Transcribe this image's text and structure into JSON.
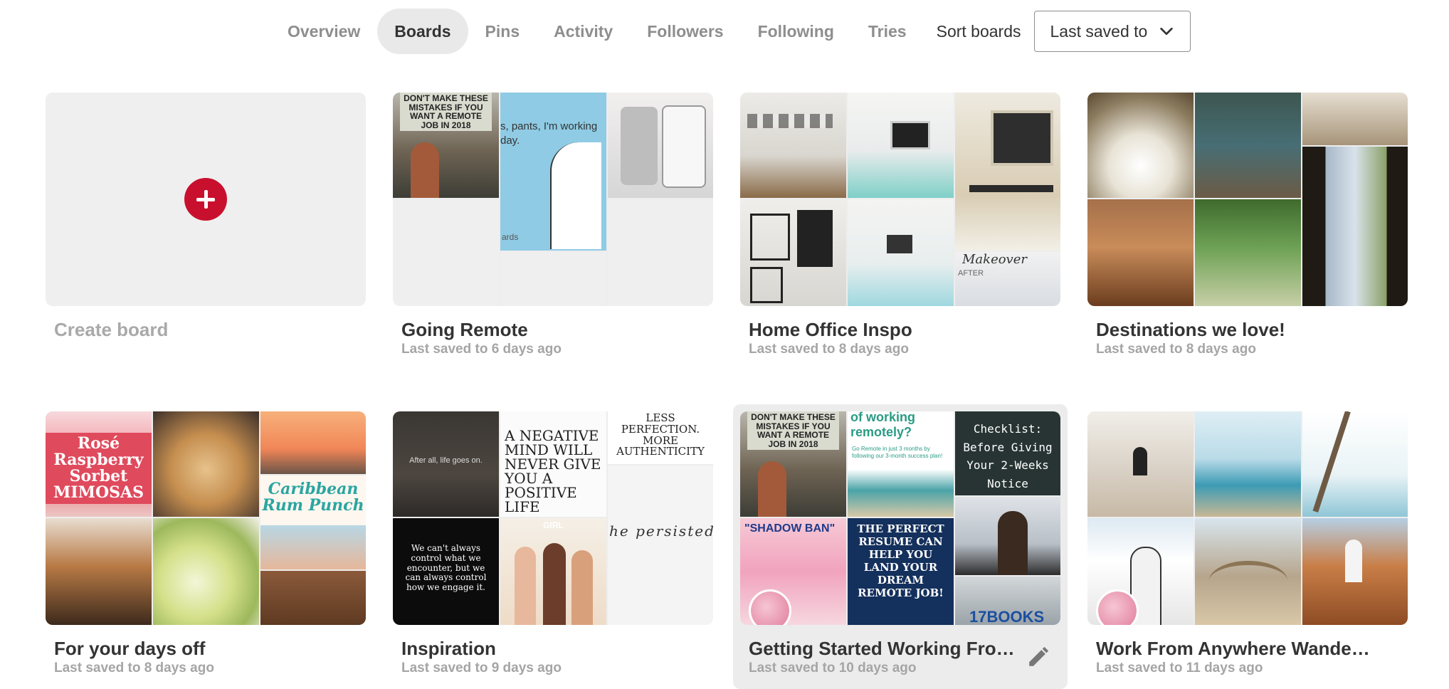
{
  "nav": {
    "tabs": [
      "Overview",
      "Boards",
      "Pins",
      "Activity",
      "Followers",
      "Following",
      "Tries"
    ],
    "active_tab": "Boards",
    "sort_label": "Sort boards",
    "sort_value": "Last saved to"
  },
  "create_board": {
    "label": "Create board"
  },
  "boards": [
    {
      "title": "Going Remote",
      "meta": "Last saved to 6 days ago",
      "tile_texts": [
        "DON'T MAKE THESE MISTAKES IF YOU WANT A REMOTE JOB IN 2018",
        "s, pants, I'm working day.",
        "ards"
      ]
    },
    {
      "title": "Home Office Inspo",
      "meta": "Last saved to 8 days ago",
      "tile_texts": [
        "Makeover",
        "AFTER"
      ]
    },
    {
      "title": "Destinations we love!",
      "meta": "Last saved to 8 days ago",
      "tile_texts": []
    },
    {
      "title": "For your days off",
      "meta": "Last saved to 8 days ago",
      "tile_texts": [
        "Rosé Raspberry Sorbet MIMOSAS",
        "Caribbean Rum Punch"
      ]
    },
    {
      "title": "Inspiration",
      "meta": "Last saved to 9 days ago",
      "tile_texts": [
        "After all, life goes on.",
        "A NEGATIVE MIND WILL NEVER GIVE YOU A POSITIVE LIFE",
        "LESS PERFECTION. MORE AUTHENTICITY",
        "We can't always control what we encounter, but we can always control how we engage it.",
        "GIRL",
        "he persisted"
      ]
    },
    {
      "title": "Getting Started Working From Home",
      "meta": "Last saved to 10 days ago",
      "tile_texts": [
        "DON'T MAKE THESE MISTAKES IF YOU WANT A REMOTE JOB IN 2018",
        "of working remotely?",
        "Go Remote in just 3 months by following our 3-month success plan!",
        "Checklist: Before Giving Your 2-Weeks Notice",
        "\"SHADOW BAN\"",
        "THE PERFECT RESUME CAN HELP YOU LAND YOUR DREAM REMOTE JOB!",
        "17BOOKS"
      ]
    },
    {
      "title": "Work From Anywhere Wanderlust",
      "meta": "Last saved to 11 days ago",
      "tile_texts": []
    }
  ],
  "colors": {
    "accent_red": "#c8102e",
    "tab_active_bg": "#e9e9e9",
    "muted_text": "#a5a5a5"
  }
}
